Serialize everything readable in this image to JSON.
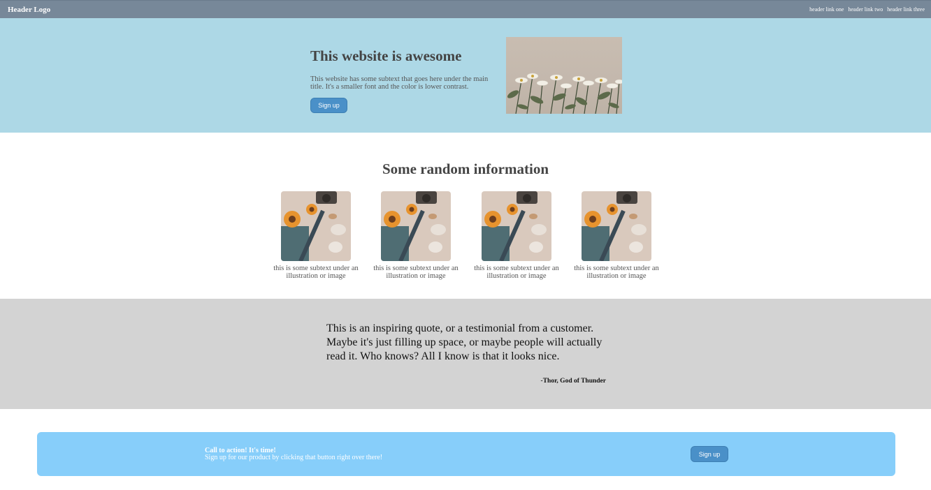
{
  "header": {
    "logo": "Header Logo",
    "links": [
      "header link one",
      "header link two",
      "header link three"
    ]
  },
  "hero": {
    "title": "This website is awesome",
    "subtext": "This website has some subtext that goes here under the main title. It's a smaller font and the color is lower contrast.",
    "button_label": "Sign up"
  },
  "info": {
    "title": "Some random information",
    "cards": [
      {
        "caption": "this is some subtext under an illustration or image"
      },
      {
        "caption": "this is some subtext under an illustration or image"
      },
      {
        "caption": "this is some subtext under an illustration or image"
      },
      {
        "caption": "this is some subtext under an illustration or image"
      }
    ]
  },
  "quote": {
    "text": "This is an inspiring quote, or a testimonial from a customer. Maybe it's just filling up space, or maybe people will actually read it. Who knows? All I know is that it looks nice.",
    "author": "-Thor, God of Thunder"
  },
  "cta": {
    "title": "Call to action! It's time!",
    "subtext": "Sign up for our product by clicking that button right over there!",
    "button_label": "Sign up"
  },
  "colors": {
    "header_bg": "#778899",
    "hero_bg": "#add8e6",
    "quote_bg": "#d3d3d3",
    "cta_bg": "#87cefa",
    "button_bg": "#4a90c8"
  }
}
